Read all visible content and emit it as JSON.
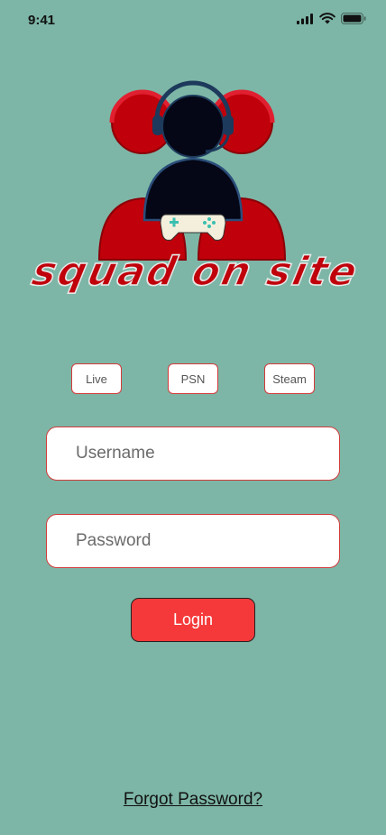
{
  "status_bar": {
    "time": "9:41"
  },
  "branding": {
    "logo_text": "squad on site",
    "colors": {
      "background": "#7db6a6",
      "accent_red": "#f5393a",
      "logo_red": "#c0000a",
      "logo_dark": "#050716",
      "border_red": "#d23b3b"
    }
  },
  "platforms": [
    {
      "label": "Live"
    },
    {
      "label": "PSN"
    },
    {
      "label": "Steam"
    }
  ],
  "form": {
    "username_placeholder": "Username",
    "password_placeholder": "Password",
    "login_label": "Login",
    "forgot_label": "Forgot Password?"
  },
  "icons": [
    "signal-icon",
    "wifi-icon",
    "battery-icon",
    "gamepad-icon"
  ]
}
